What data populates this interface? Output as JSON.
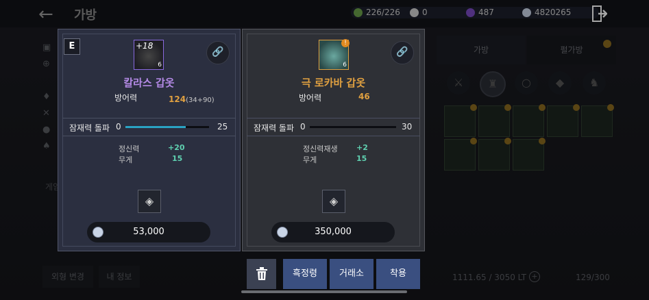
{
  "header": {
    "title": "가방",
    "resources": [
      {
        "icon": "inventory-icon",
        "value": "226/226",
        "color": "#6aa04a"
      },
      {
        "icon": "pearl-icon",
        "value": "0",
        "color": "#d0d0d0"
      },
      {
        "icon": "purple-gem-icon",
        "value": "487",
        "color": "#7a4bc2"
      },
      {
        "icon": "silver-coin-icon",
        "value": "4820265",
        "color": "#c9d4e6"
      }
    ]
  },
  "right_panel": {
    "tabs": [
      "가방",
      "펄가방"
    ],
    "weight": "1111.65 / 3050 LT",
    "slots": "129/300"
  },
  "left_bottom": {
    "buttons": [
      "외형 변경",
      "내 정보"
    ],
    "section_label": "게임"
  },
  "compare_left": {
    "equipped_badge": "E",
    "enhance_level": "+18",
    "grade_number": "6",
    "name": "칼라스 갑옷",
    "name_color": "#b48ae6",
    "stat_label": "방어력",
    "stat_value": "124",
    "stat_detail": "(34+90)",
    "potential_label": "잠재력 돌파",
    "potential_min": "0",
    "potential_max": "25",
    "potential_fraction": 0.72,
    "sub_stats": [
      {
        "name": "정신력",
        "value": "+20"
      },
      {
        "name": "무게",
        "value": "15"
      }
    ],
    "price": "53,000"
  },
  "compare_right": {
    "grade_number": "6",
    "name": "극 로카바 갑옷",
    "name_color": "#e0a040",
    "stat_label": "방어력",
    "stat_value": "46",
    "potential_label": "잠재력 돌파",
    "potential_min": "0",
    "potential_max": "30",
    "potential_fraction": 0.0,
    "sub_stats": [
      {
        "name": "정신력재생",
        "value": "+2"
      },
      {
        "name": "무게",
        "value": "15"
      }
    ],
    "price": "350,000"
  },
  "actions": {
    "buttons": [
      "흑정령",
      "거래소",
      "착용"
    ]
  }
}
